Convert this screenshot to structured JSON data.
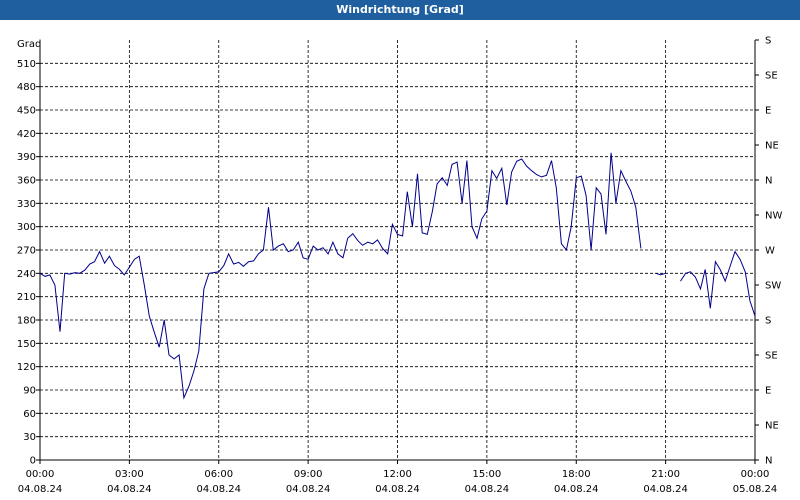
{
  "window": {
    "title": "Windrichtung [Grad]"
  },
  "chart_data": {
    "type": "line",
    "title": "Windrichtung [Grad]",
    "ylabel": "Grad",
    "ylim": [
      0,
      540
    ],
    "y_ticks": [
      0,
      30,
      60,
      90,
      120,
      150,
      180,
      210,
      240,
      270,
      300,
      330,
      360,
      390,
      420,
      450,
      480,
      510
    ],
    "y2_tick_labels": [
      "N",
      "NE",
      "E",
      "SE",
      "S",
      "SW",
      "W",
      "NW",
      "N",
      "NE",
      "E",
      "SE",
      "S"
    ],
    "x_range_hours": [
      0,
      24
    ],
    "x_tick_labels": [
      {
        "time": "00:00",
        "date": "04.08.24"
      },
      {
        "time": "03:00",
        "date": "04.08.24"
      },
      {
        "time": "06:00",
        "date": "04.08.24"
      },
      {
        "time": "09:00",
        "date": "04.08.24"
      },
      {
        "time": "12:00",
        "date": "04.08.24"
      },
      {
        "time": "15:00",
        "date": "04.08.24"
      },
      {
        "time": "18:00",
        "date": "04.08.24"
      },
      {
        "time": "21:00",
        "date": "04.08.24"
      },
      {
        "time": "00:00",
        "date": "05.08.24"
      }
    ],
    "grid": true,
    "line_color": "#00008b",
    "series": [
      {
        "x_hours": [
          0.0,
          0.17,
          0.33,
          0.5,
          0.67,
          0.83,
          1.0,
          1.17,
          1.33,
          1.5,
          1.67,
          1.83,
          2.0,
          2.17,
          2.33,
          2.5,
          2.67,
          2.83,
          3.0,
          3.17,
          3.33,
          3.5,
          3.67,
          3.83,
          4.0,
          4.17,
          4.33,
          4.5,
          4.67,
          4.83,
          5.0,
          5.17,
          5.33,
          5.5,
          5.67,
          5.83,
          6.0,
          6.17,
          6.33,
          6.5,
          6.67,
          6.83,
          7.0,
          7.17,
          7.33,
          7.5,
          7.67,
          7.83,
          8.0,
          8.17,
          8.33,
          8.5,
          8.67,
          8.83,
          9.0,
          9.17,
          9.33,
          9.5,
          9.67,
          9.83,
          10.0,
          10.17,
          10.33,
          10.5,
          10.67,
          10.83,
          11.0,
          11.17,
          11.33,
          11.5,
          11.67,
          11.83,
          12.0,
          12.17,
          12.33,
          12.5,
          12.67,
          12.83,
          13.0,
          13.17,
          13.33,
          13.5,
          13.67,
          13.83,
          14.0,
          14.17,
          14.33,
          14.5,
          14.67,
          14.83,
          15.0,
          15.17,
          15.33,
          15.5,
          15.67,
          15.83,
          16.0,
          16.17,
          16.33,
          16.5,
          16.67,
          16.83,
          17.0,
          17.17,
          17.33,
          17.5,
          17.67,
          17.83,
          18.0,
          18.17,
          18.33,
          18.5,
          18.67,
          18.83,
          19.0,
          19.17,
          19.33,
          19.5,
          19.67,
          19.83,
          20.0,
          20.17,
          20.33,
          20.5,
          20.67,
          20.83,
          21.0,
          21.17,
          21.33,
          21.5,
          21.67,
          21.83,
          22.0,
          22.17,
          22.33,
          22.5,
          22.67,
          22.83,
          23.0,
          23.17,
          23.33,
          23.5,
          23.67,
          23.83,
          24.0
        ],
        "values": [
          240,
          236,
          238,
          225,
          165,
          240,
          239,
          241,
          240,
          244,
          252,
          255,
          268,
          253,
          262,
          250,
          245,
          238,
          248,
          258,
          262,
          225,
          185,
          165,
          145,
          180,
          135,
          130,
          135,
          80,
          95,
          115,
          140,
          220,
          240,
          241,
          242,
          250,
          265,
          252,
          254,
          249,
          255,
          256,
          265,
          270,
          325,
          270,
          275,
          278,
          268,
          270,
          280,
          260,
          258,
          275,
          270,
          273,
          265,
          280,
          265,
          260,
          285,
          291,
          282,
          276,
          280,
          278,
          283,
          272,
          265,
          303,
          290,
          288,
          345,
          300,
          368,
          292,
          290,
          320,
          355,
          363,
          353,
          380,
          383,
          330,
          385,
          300,
          285,
          310,
          320,
          372,
          362,
          375,
          328,
          370,
          384,
          387,
          378,
          372,
          367,
          364,
          366,
          385,
          350,
          278,
          270,
          300,
          363,
          365,
          340,
          270,
          350,
          342,
          290,
          395,
          330,
          372,
          358,
          346,
          325,
          272,
          null,
          null,
          240,
          238,
          240,
          null,
          null,
          230,
          240,
          242,
          235,
          220,
          245,
          195,
          255,
          245,
          230,
          250,
          268,
          258,
          242,
          205,
          185,
          175
        ]
      }
    ]
  }
}
